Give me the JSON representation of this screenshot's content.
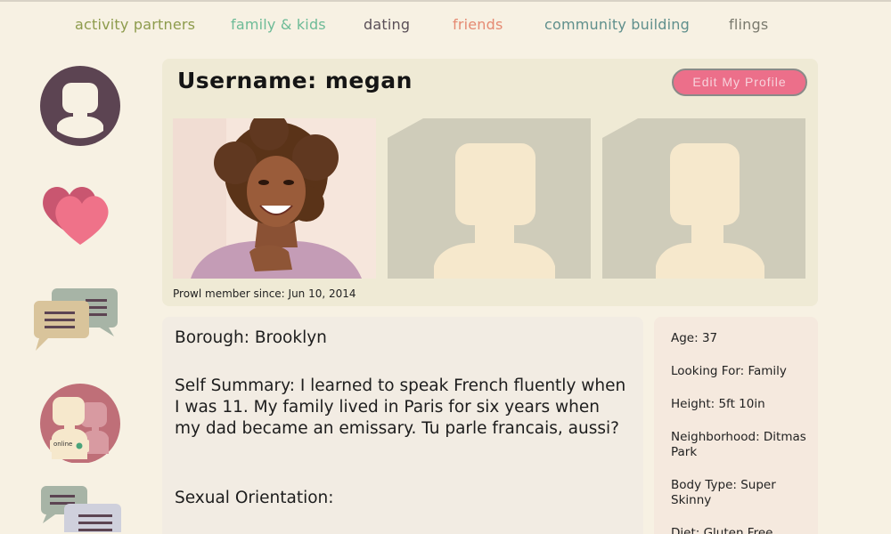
{
  "nav": {
    "items": [
      {
        "label": "activity partners",
        "color": "#8d9b4c"
      },
      {
        "label": "family & kids",
        "color": "#6dbb97"
      },
      {
        "label": "dating",
        "color": "#5a4f57"
      },
      {
        "label": "friends",
        "color": "#e58a72"
      },
      {
        "label": "community building",
        "color": "#5f8f8c"
      },
      {
        "label": "flings",
        "color": "#7a7a6e"
      }
    ]
  },
  "sidebar": {
    "online_label": "online",
    "icons": [
      "profile-icon",
      "hearts-icon",
      "chat-icon",
      "online-users-icon",
      "messages-icon"
    ]
  },
  "profile": {
    "username": "Username: megan",
    "edit_button": "Edit My Profile",
    "member_since": "Prowl member since: Jun 10, 2014"
  },
  "details": {
    "borough": "Borough: Brooklyn",
    "summary": "Self Summary: I learned to speak French fluently when I was 11. My family lived in Paris for six years when my dad became an emissary. Tu parle francais, aussi?",
    "orientation": "Sexual Orientation:"
  },
  "stats": {
    "age": "Age: 37",
    "looking_for": "Looking For: Family",
    "height": "Height: 5ft 10in",
    "neighborhood": "Neighborhood: Ditmas Park",
    "body_type": "Body Type: Super Skinny",
    "diet": "Diet: Gluten Free"
  },
  "colors": {
    "background": "#f7f1e3",
    "card": "#efead5",
    "accent_pink": "#ec6f8a",
    "placeholder_bg": "#cfccba",
    "placeholder_figure": "#f6e8cc",
    "avatar_purple": "#5c4452"
  }
}
